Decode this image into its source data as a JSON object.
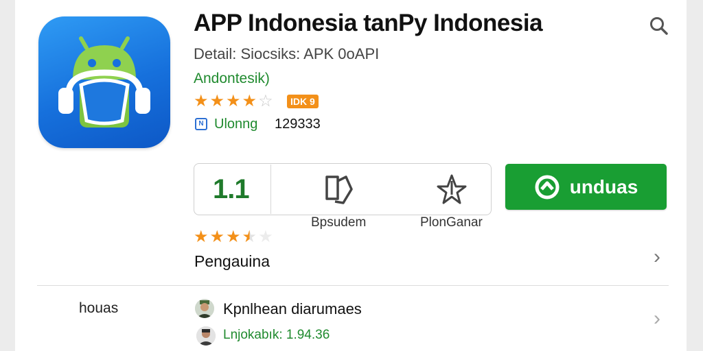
{
  "app": {
    "title": "APP Indonesia tanPy Indonesia",
    "subtitle": "Detail: Siocsiks: APK 0oAPI",
    "developer": "Andontesik)",
    "stars": [
      1,
      1,
      1,
      1,
      0
    ],
    "badge": "IDK 9",
    "meta_label": "Ulonng",
    "meta_count": "129333"
  },
  "stats": {
    "rating": "1.1",
    "rating_stars": [
      1,
      1,
      1,
      0.5,
      0
    ],
    "actions": [
      {
        "label": "Bpsudem",
        "icon": "bookmark-icon"
      },
      {
        "label": "PlonGanar",
        "icon": "share-star-icon"
      }
    ]
  },
  "download_button": {
    "label": "unduas",
    "icon": "download-circle-icon"
  },
  "section": {
    "label": "Pengauina"
  },
  "reviews": {
    "row_label": "houas",
    "user_name": "Kpnlhean diarumaes",
    "user_meta": "Lnjokabık: 1.94.36"
  },
  "colors": {
    "accent_green": "#199e33",
    "star_orange": "#f39019",
    "icon_blue": "#1670dc"
  }
}
